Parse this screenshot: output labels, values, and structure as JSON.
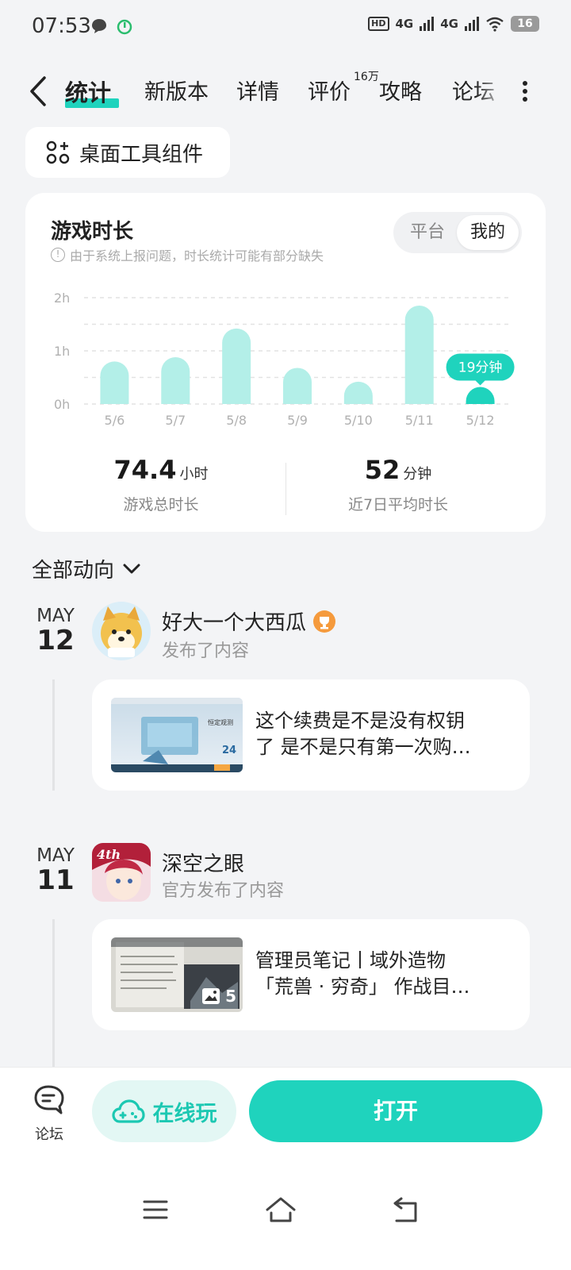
{
  "status": {
    "time": "07:53",
    "battery": "16",
    "net1": "4G",
    "net2": "4G",
    "hd": "HD"
  },
  "tabs": {
    "items": [
      "统计",
      "新版本",
      "详情",
      "评价",
      "攻略",
      "论坛"
    ],
    "review_badge": "16万"
  },
  "widget": {
    "label": "桌面工具组件"
  },
  "playtime": {
    "title": "游戏时长",
    "note": "由于系统上报问题，时长统计可能有部分缺失",
    "segments": [
      "平台",
      "我的"
    ],
    "selected_segment": "我的",
    "total_value": "74.4",
    "total_unit": "小时",
    "total_label": "游戏总时长",
    "avg_value": "52",
    "avg_unit": "分钟",
    "avg_label": "近7日平均时长",
    "accent": "#1fd3bd",
    "bar_color": "#b3efe8"
  },
  "chart_data": {
    "type": "bar",
    "categories": [
      "5/6",
      "5/7",
      "5/8",
      "5/9",
      "5/10",
      "5/11",
      "5/12"
    ],
    "values": [
      0.8,
      0.88,
      1.42,
      0.68,
      0.42,
      1.85,
      0.32
    ],
    "yticks": [
      "2h",
      "1h",
      "0h"
    ],
    "ylim": [
      0,
      2
    ],
    "highlight_index": 6,
    "highlight_label": "19分钟",
    "grid": true
  },
  "feed": {
    "filter_label": "全部动向",
    "posts": [
      {
        "month": "MAY",
        "day": "12",
        "author": "好大一个大西瓜",
        "action": "发布了内容",
        "line1": "这个续费是不是没有权钥",
        "line2": "了 是不是只有第一次购…",
        "thumb_text": "恒定观测",
        "thumb_number": "24"
      },
      {
        "month": "MAY",
        "day": "11",
        "author": "深空之眼",
        "action": "官方发布了内容",
        "line1": "管理员笔记丨域外造物",
        "line2": "「荒兽 · 穷奇」 作战目…",
        "image_count": "5",
        "icon_text": "4th"
      }
    ]
  },
  "actions": {
    "forum": "论坛",
    "play_online": "在线玩",
    "open": "打开"
  }
}
